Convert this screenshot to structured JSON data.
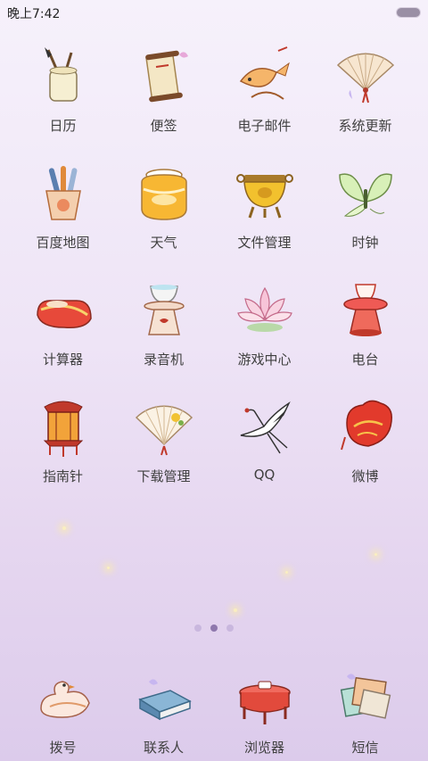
{
  "status_bar": {
    "time": "晚上7:42"
  },
  "apps": [
    {
      "label": "日历",
      "icon": "brush-pot-icon"
    },
    {
      "label": "便签",
      "icon": "scroll-icon"
    },
    {
      "label": "电子邮件",
      "icon": "koi-fish-icon"
    },
    {
      "label": "系统更新",
      "icon": "folding-fan-icon"
    },
    {
      "label": "百度地图",
      "icon": "scroll-vase-icon"
    },
    {
      "label": "天气",
      "icon": "porcelain-jar-icon"
    },
    {
      "label": "文件管理",
      "icon": "bronze-cauldron-icon"
    },
    {
      "label": "时钟",
      "icon": "butterfly-icon"
    },
    {
      "label": "计算器",
      "icon": "embroidered-shoe-icon"
    },
    {
      "label": "录音机",
      "icon": "teacup-stand-icon"
    },
    {
      "label": "游戏中心",
      "icon": "lotus-icon"
    },
    {
      "label": "电台",
      "icon": "red-lantern-stand-icon"
    },
    {
      "label": "指南针",
      "icon": "palace-lantern-icon"
    },
    {
      "label": "下载管理",
      "icon": "painted-fan-icon"
    },
    {
      "label": "QQ",
      "icon": "crane-icon"
    },
    {
      "label": "微博",
      "icon": "red-pouch-icon"
    }
  ],
  "pager": {
    "pages": 3,
    "active": 2
  },
  "dock": [
    {
      "label": "拨号",
      "icon": "mandarin-duck-icon"
    },
    {
      "label": "联系人",
      "icon": "book-icon"
    },
    {
      "label": "浏览器",
      "icon": "red-table-icon"
    },
    {
      "label": "短信",
      "icon": "letters-icon"
    }
  ],
  "colors": {
    "accent": "#8f78ad",
    "background_top": "#f6f1fb",
    "background_bottom": "#dccbeb"
  }
}
